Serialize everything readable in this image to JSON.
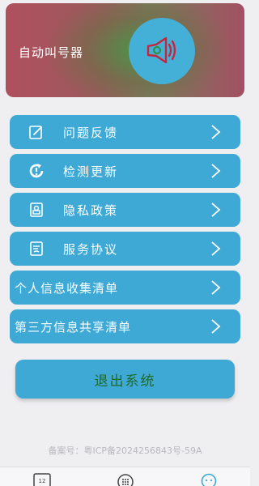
{
  "header": {
    "title": "自动叫号器",
    "logo_icon": "speaker-icon"
  },
  "menu": [
    {
      "label": "问题反馈",
      "icon": "feedback-icon"
    },
    {
      "label": "检测更新",
      "icon": "update-icon"
    },
    {
      "label": "隐私政策",
      "icon": "privacy-icon"
    },
    {
      "label": "服务协议",
      "icon": "agreement-icon"
    },
    {
      "label": "个人信息收集清单",
      "icon": ""
    },
    {
      "label": "第三方信息共享清单",
      "icon": ""
    }
  ],
  "logout_label": "退出系统",
  "icp_text": "备案号：粤ICP备2024256843号-59A",
  "tabbar": {
    "tab1_icon": "calendar-icon",
    "tab1_text": "12",
    "tab2_icon": "keypad-icon",
    "tab3_icon": "profile-icon"
  },
  "colors": {
    "accent": "#3fa9d6",
    "logout_text": "#1f6a2a",
    "background": "#efeff2"
  }
}
